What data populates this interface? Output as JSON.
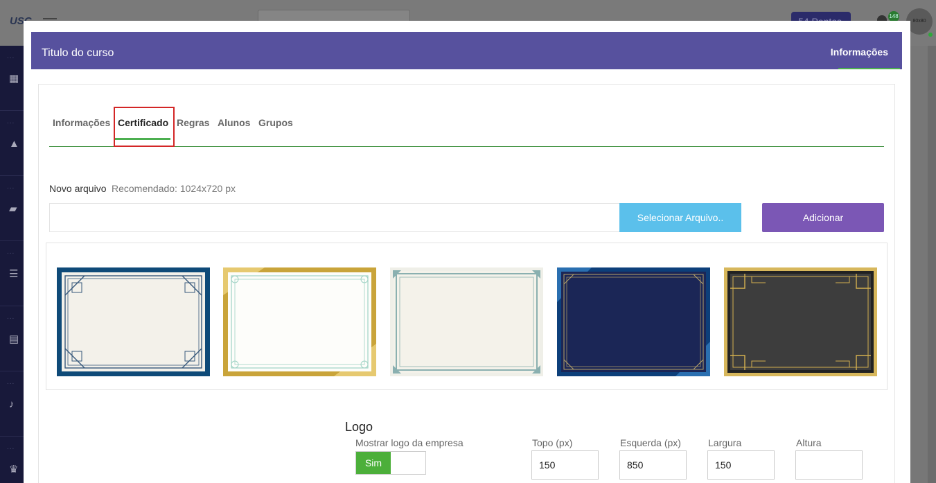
{
  "background": {
    "logo": "USC",
    "points": "54 Pontos",
    "notification_count": "148",
    "avatar_label": "80x80"
  },
  "modal": {
    "title": "Titulo do curso",
    "header_tab": "Informações",
    "tabs": [
      {
        "label": "Informações",
        "active": false
      },
      {
        "label": "Certificado",
        "active": true
      },
      {
        "label": "Regras",
        "active": false
      },
      {
        "label": "Alunos",
        "active": false
      },
      {
        "label": "Grupos",
        "active": false
      }
    ],
    "upload": {
      "label": "Novo arquivo",
      "hint": "Recomendado: 1024x720 px",
      "file_value": "",
      "select_label": "Selecionar Arquivo..",
      "add_label": "Adicionar"
    },
    "templates": [
      {
        "name": "blue-classic",
        "frame": "#0e4a78",
        "paper": "#f3f1ea",
        "ornament": "#35577a"
      },
      {
        "name": "gold-light",
        "frame": "#c9a43a",
        "paper": "#fdfdfa",
        "ornament": "#9ed2c4"
      },
      {
        "name": "cream-simple",
        "frame": "#efefe8",
        "paper": "#f4f2ea",
        "ornament": "#8ab0b0"
      },
      {
        "name": "navy-dark",
        "frame": "#0d3f7a",
        "paper": "#1b2656",
        "ornament": "#b8a46a"
      },
      {
        "name": "black-gold",
        "frame": "#d7b75c",
        "paper": "#3d3d3d",
        "ornament": "#d4b04f"
      }
    ],
    "logo_section": {
      "title": "Logo",
      "show_logo_label": "Mostrar logo da empresa",
      "toggle_value": "Sim",
      "top_label": "Topo (px)",
      "top_value": "150",
      "left_label": "Esquerda (px)",
      "left_value": "850",
      "width_label": "Largura",
      "width_value": "150",
      "height_label": "Altura",
      "height_value": ""
    }
  }
}
